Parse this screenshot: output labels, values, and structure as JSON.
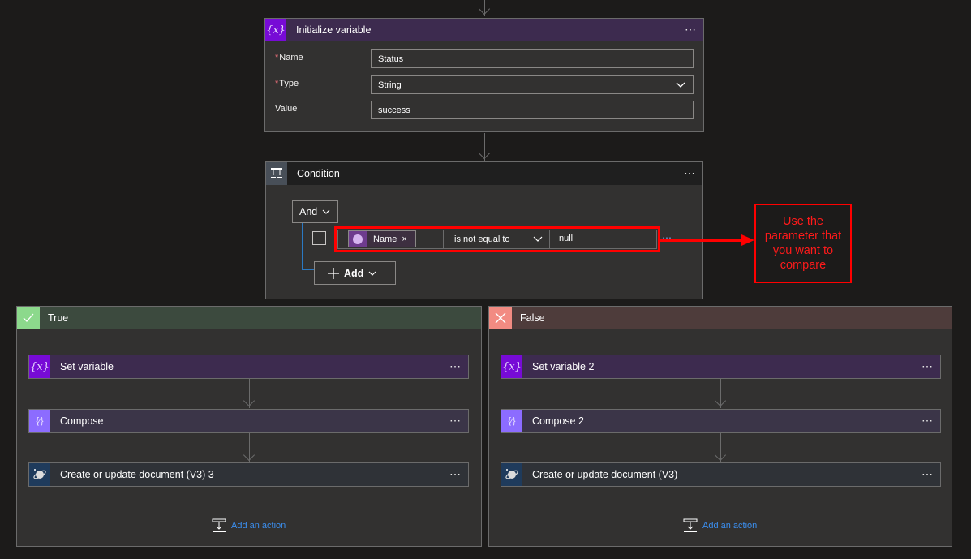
{
  "init_variable": {
    "title": "Initialize variable",
    "icon": "variable-icon",
    "more": "⋯",
    "fields": [
      {
        "label": "Name",
        "required": true,
        "value": "Status"
      },
      {
        "label": "Type",
        "required": true,
        "value": "String"
      },
      {
        "label": "Value",
        "required": false,
        "value": "success"
      }
    ],
    "required_mark": "*"
  },
  "condition": {
    "title": "Condition",
    "icon": "condition-icon",
    "more": "⋯",
    "group_operator": "And",
    "row": {
      "token_label": "Name",
      "token_remove": "×",
      "operator": "is not equal to",
      "value": "null"
    },
    "row_more": "⋯",
    "add_label": "Add"
  },
  "annotation": {
    "text": "Use the parameter that you want to compare",
    "color": "#ff0000"
  },
  "branches": {
    "true": {
      "label": "True",
      "header_color": "#3c4a3e",
      "icon_color": "#8cd98c",
      "actions": [
        {
          "title": "Set variable",
          "icon": "variable-icon",
          "more": "⋯"
        },
        {
          "title": "Compose",
          "icon": "compose-icon",
          "more": "⋯"
        },
        {
          "title": "Create or update document (V3) 3",
          "icon": "cosmos-db-icon",
          "more": "⋯"
        }
      ],
      "add_action": "Add an action"
    },
    "false": {
      "label": "False",
      "header_color": "#4e3c3b",
      "icon_color": "#f28b82",
      "actions": [
        {
          "title": "Set variable 2",
          "icon": "variable-icon",
          "more": "⋯"
        },
        {
          "title": "Compose 2",
          "icon": "compose-icon",
          "more": "⋯"
        },
        {
          "title": "Create or update document (V3)",
          "icon": "cosmos-db-icon",
          "more": "⋯"
        }
      ],
      "add_action": "Add an action"
    }
  },
  "colors": {
    "variable_accent": "#770bd6",
    "variable_header": "#3d2b4f",
    "compose_accent": "#8c6cff",
    "compose_header": "#3b3548",
    "cosmos_accent": "#1f3b5c",
    "cosmos_header": "#2f3237",
    "condition_accent": "#484f58",
    "link": "#3b8ff0"
  }
}
